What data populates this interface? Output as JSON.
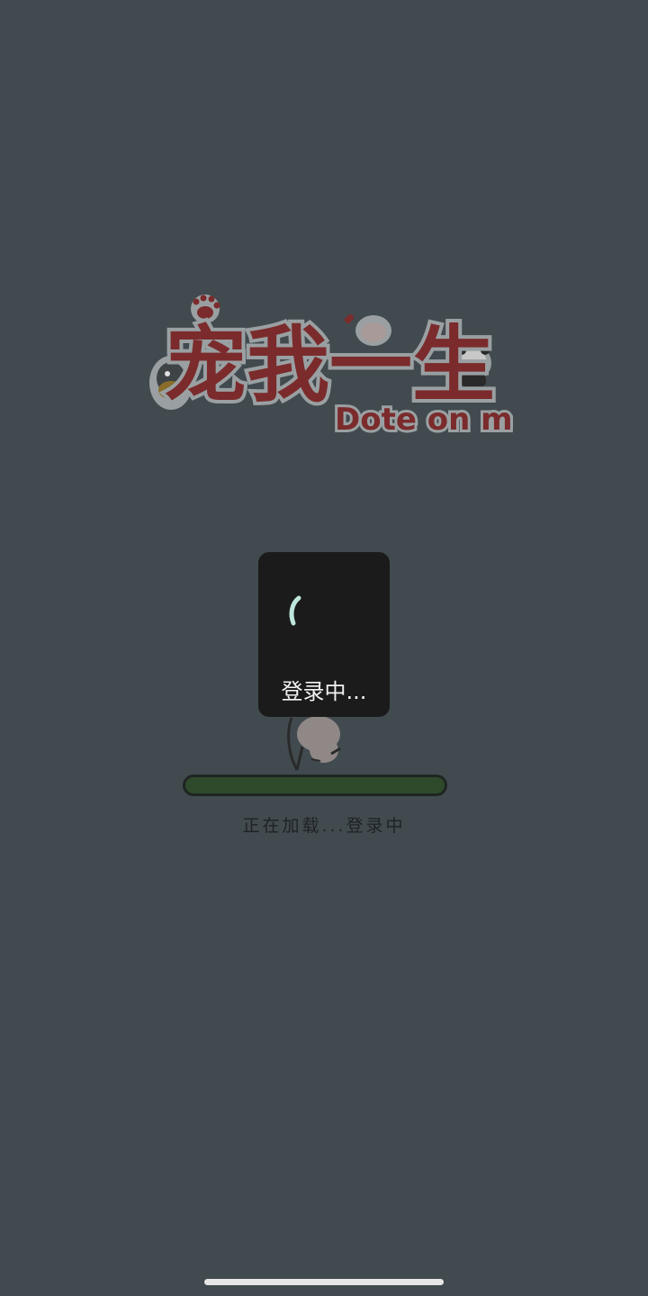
{
  "logo": {
    "title": "宠我一生",
    "subtitle": "Dote on me"
  },
  "loading": {
    "status_text": "正在加载...登录中",
    "progress": 1.0
  },
  "toast": {
    "label": "登录中..."
  },
  "colors": {
    "background": "#414a4f",
    "logo_red": "#7b2b2c",
    "progress_green": "#2e4a2b",
    "toast_bg": "#1b1b1b",
    "spinner_accent": "#bfe6dc"
  },
  "icons": {
    "paw": "paw-icon",
    "spinner": "loading-spinner-icon",
    "runner": "running-pet-icon"
  }
}
